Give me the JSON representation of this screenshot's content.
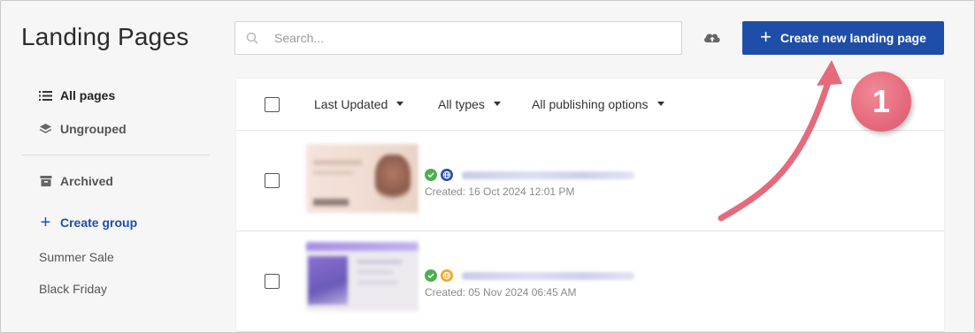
{
  "header": {
    "title": "Landing Pages",
    "search_placeholder": "Search...",
    "search_value": "",
    "create_button_label": "Create new landing page",
    "upload_icon": "cloud-upload-icon"
  },
  "sidebar": {
    "items": [
      {
        "label": "All pages",
        "icon": "list-icon",
        "active": true
      },
      {
        "label": "Ungrouped",
        "icon": "layers-icon",
        "active": false
      },
      {
        "label": "Archived",
        "icon": "archive-icon",
        "active": false
      }
    ],
    "create_group_label": "Create group",
    "groups": [
      "Summer Sale",
      "Black Friday"
    ]
  },
  "toolbar": {
    "filters": [
      "Last Updated",
      "All types",
      "All publishing options"
    ]
  },
  "rows": [
    {
      "created": "Created: 16 Oct 2024 12:01 PM",
      "status_color": "#4caf50",
      "publish_color": "#2a4fa3"
    },
    {
      "created": "Created: 05 Nov 2024 06:45 AM",
      "status_color": "#4caf50",
      "publish_color": "#f0a824"
    }
  ],
  "annotation": {
    "step_number": "1",
    "color": "#e56a7c"
  },
  "colors": {
    "accent": "#1f4ea8",
    "background": "#f6f6f6"
  }
}
